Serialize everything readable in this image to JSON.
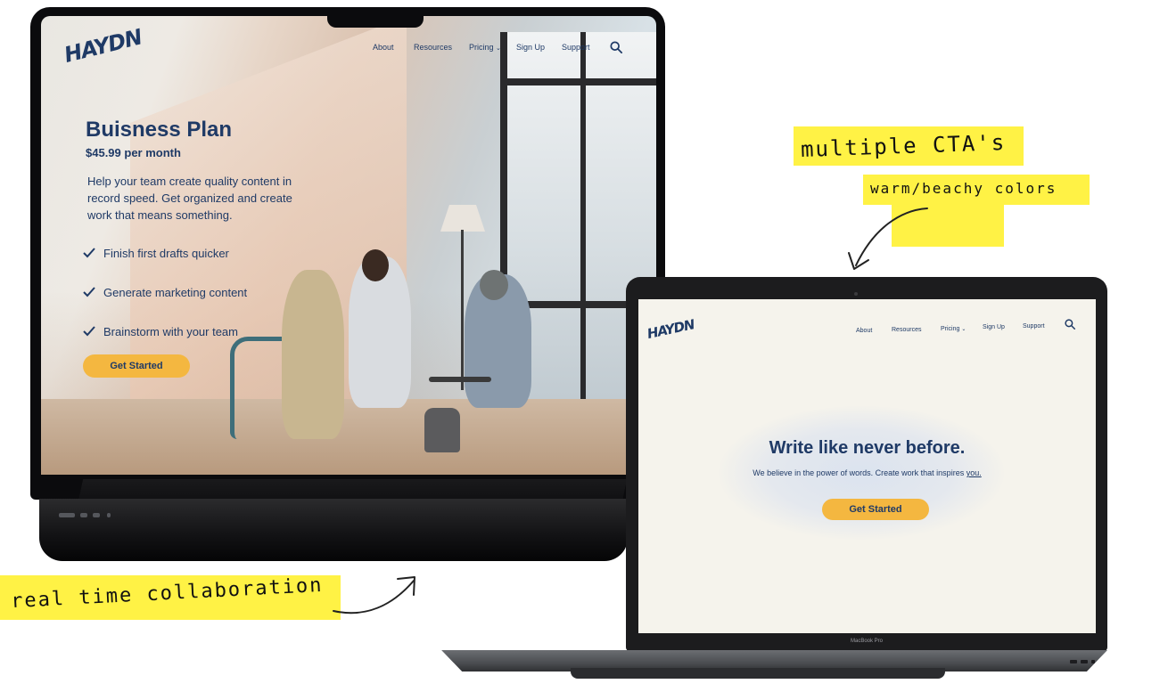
{
  "left_screen": {
    "logo": "HAYDN",
    "nav": {
      "about": "About",
      "resources": "Resources",
      "pricing": "Pricing",
      "sign_up": "Sign Up",
      "support": "Support"
    },
    "title": "Buisness Plan",
    "price": "$45.99 per month",
    "description": "Help your team create quality content in record speed. Get organized and create work that means something.",
    "features": [
      "Finish first drafts quicker",
      "Generate marketing content",
      "Brainstorm with your team"
    ],
    "cta": "Get Started"
  },
  "right_screen": {
    "logo": "HAYDN",
    "nav": {
      "about": "About",
      "resources": "Resources",
      "pricing": "Pricing",
      "sign_up": "Sign Up",
      "support": "Support"
    },
    "headline": "Write like never before.",
    "subtext": "We believe in the power of words. Create work that inspires",
    "subtext_emphasis": "you.",
    "cta": "Get Started",
    "bezel_label": "MacBook Pro"
  },
  "annotations": {
    "cta_note": "multiple CTA's",
    "colors_note": "warm/beachy colors",
    "collab_note": "real time collaboration"
  },
  "colors": {
    "brand_navy": "#1f3a66",
    "cta_yellow": "#f4b740",
    "highlighter": "#fff245"
  }
}
